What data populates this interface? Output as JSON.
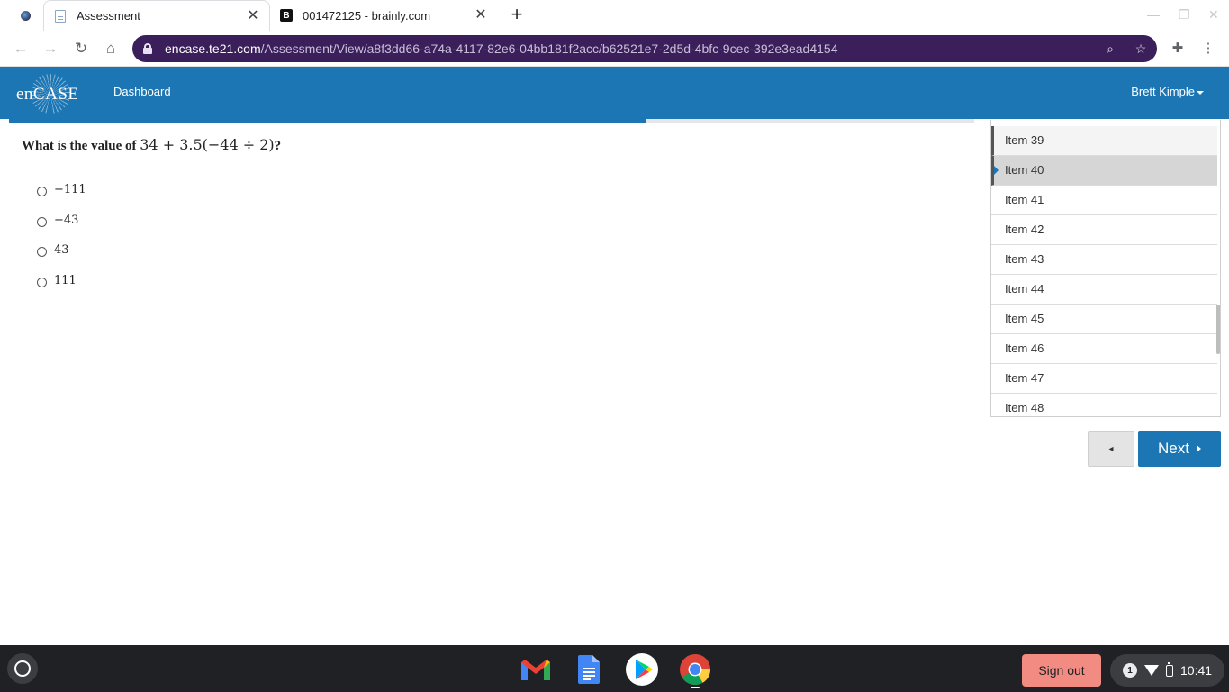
{
  "browser": {
    "tabs": [
      {
        "title": "Assessment",
        "active": true
      },
      {
        "title": "001472125 - brainly.com",
        "active": false
      }
    ],
    "new_tab_label": "+",
    "url": {
      "host": "encase.te21.com",
      "path": "/Assessment/View/a8f3dd66-a74a-4117-82e6-04bb181f2acc/b62521e7-2d5d-4bfc-9cec-392e3ead4154"
    },
    "icons": {
      "back": "back-arrow-icon",
      "forward": "forward-arrow-icon",
      "reload": "reload-icon",
      "home": "home-icon",
      "lock": "lock-icon",
      "zoom": "search-icon",
      "bookmark": "star-icon",
      "extensions": "puzzle-icon",
      "menu": "kebab-menu-icon"
    }
  },
  "app": {
    "logo_text": "enCASE",
    "nav": {
      "dashboard": "Dashboard"
    },
    "user": {
      "name": "Brett Kimple"
    },
    "progress": 0.66,
    "brand_color": "#1d76b4"
  },
  "question": {
    "prompt": "What is the value of",
    "expression": "34 + 3.5(−44 ÷ 2)",
    "suffix": "?",
    "choices": [
      "−111",
      "−43",
      "43",
      "111"
    ]
  },
  "items": [
    {
      "label": "Item 39",
      "state": "visited"
    },
    {
      "label": "Item 40",
      "state": "current"
    },
    {
      "label": "Item 41",
      "state": "default"
    },
    {
      "label": "Item 42",
      "state": "default"
    },
    {
      "label": "Item 43",
      "state": "default"
    },
    {
      "label": "Item 44",
      "state": "default"
    },
    {
      "label": "Item 45",
      "state": "default"
    },
    {
      "label": "Item 46",
      "state": "default"
    },
    {
      "label": "Item 47",
      "state": "default"
    },
    {
      "label": "Item 48",
      "state": "default"
    }
  ],
  "pager": {
    "prev_label": "◂",
    "next_label": "Next"
  },
  "shelf": {
    "apps": [
      "gmail-icon",
      "docs-icon",
      "play-store-icon",
      "chrome-icon"
    ],
    "sign_out": "Sign out",
    "notification_count": "1",
    "time": "10:41"
  }
}
